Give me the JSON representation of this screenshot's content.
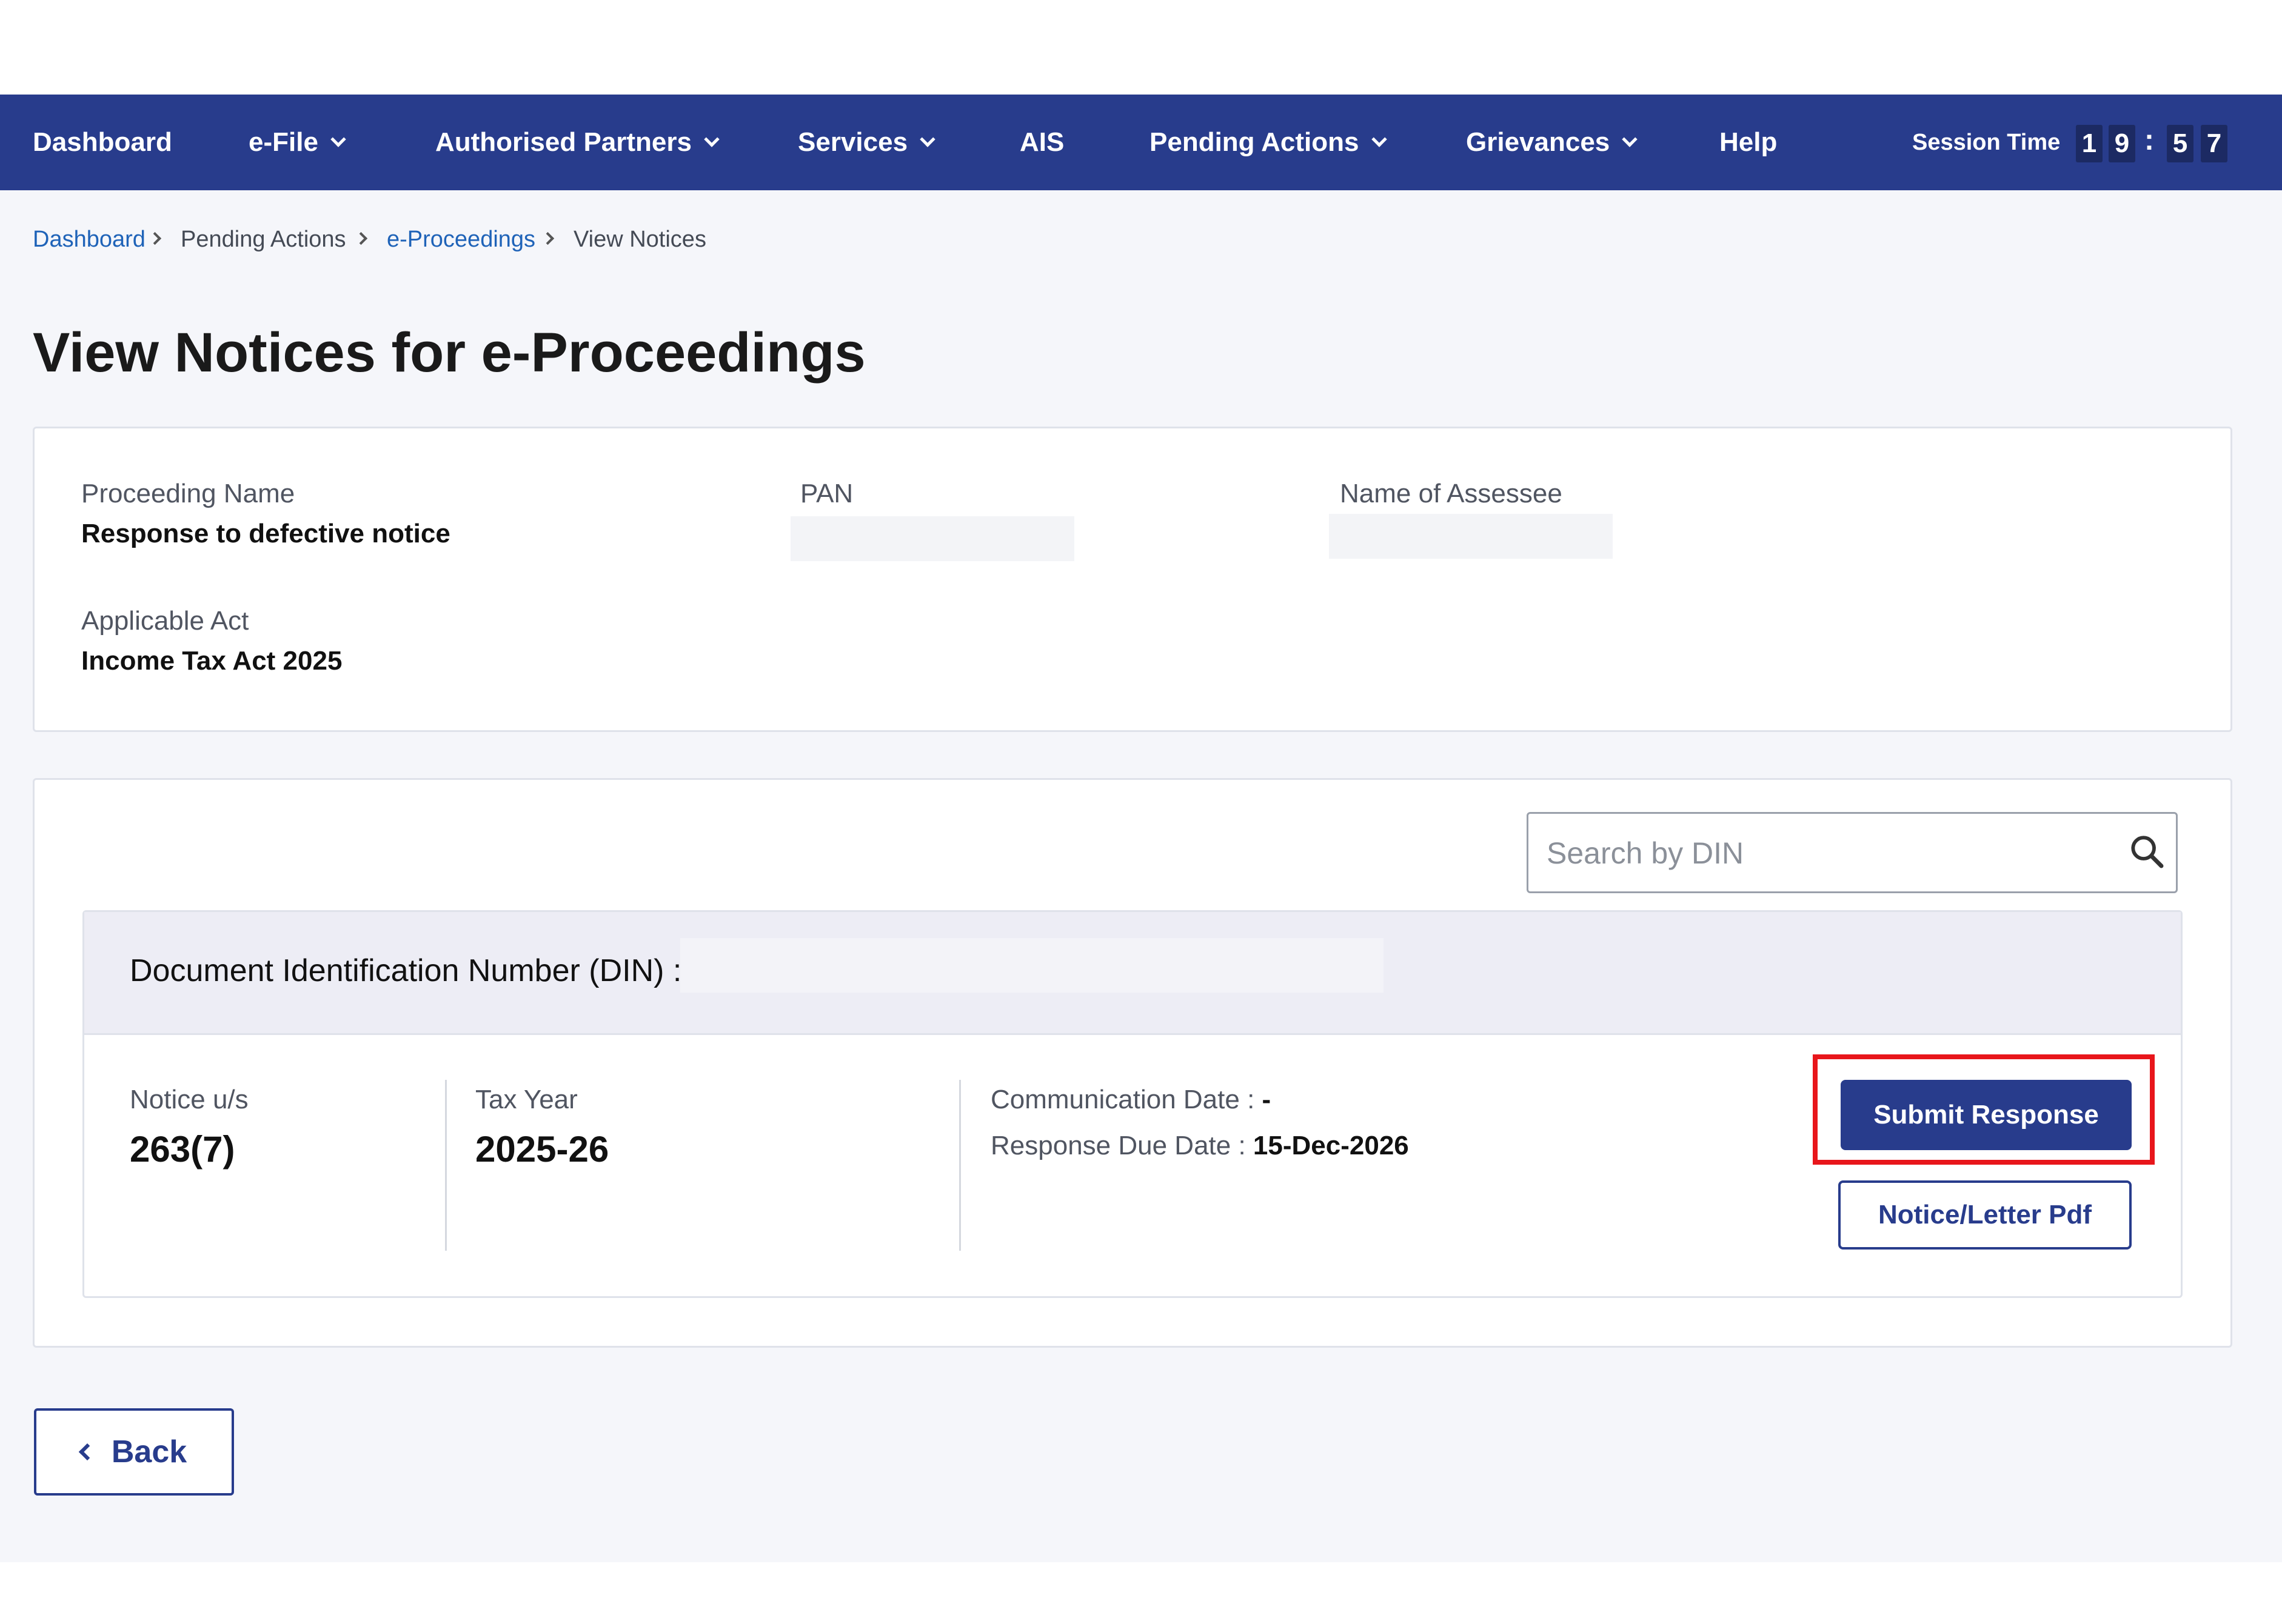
{
  "nav": {
    "items": [
      {
        "label": "Dashboard",
        "dropdown": false
      },
      {
        "label": "e-File",
        "dropdown": true
      },
      {
        "label": "Authorised Partners",
        "dropdown": true
      },
      {
        "label": "Services",
        "dropdown": true
      },
      {
        "label": "AIS",
        "dropdown": false
      },
      {
        "label": "Pending Actions",
        "dropdown": true
      },
      {
        "label": "Grievances",
        "dropdown": true
      },
      {
        "label": "Help",
        "dropdown": false
      }
    ],
    "session_label": "Session Time",
    "session_digits": [
      "1",
      "9",
      "5",
      "7"
    ],
    "session_separator": ":"
  },
  "breadcrumb": [
    "Dashboard",
    "Pending Actions",
    "e-Proceedings",
    "View Notices"
  ],
  "page_title": "View Notices for e-Proceedings",
  "proceeding": {
    "name_label": "Proceeding Name",
    "name_value": "Response to defective notice",
    "pan_label": "PAN",
    "assessee_label": "Name of Assessee",
    "act_label": "Applicable Act",
    "act_value": "Income Tax Act 2025"
  },
  "search": {
    "placeholder": "Search by DIN"
  },
  "notice": {
    "din_label": "Document Identification Number (DIN) :",
    "section_label": "Notice u/s",
    "section_value": "263(7)",
    "tax_year_label": "Tax Year",
    "tax_year_value": "2025-26",
    "comm_date_label": "Communication Date :",
    "comm_date_value": "-",
    "due_date_label": "Response Due Date :",
    "due_date_value": "15-Dec-2026",
    "submit_label": "Submit Response",
    "pdf_label": "Notice/Letter Pdf"
  },
  "back_label": "Back",
  "colors": {
    "nav_bg": "#283c8c",
    "highlight": "#e8161b",
    "link": "#1f63b8"
  }
}
